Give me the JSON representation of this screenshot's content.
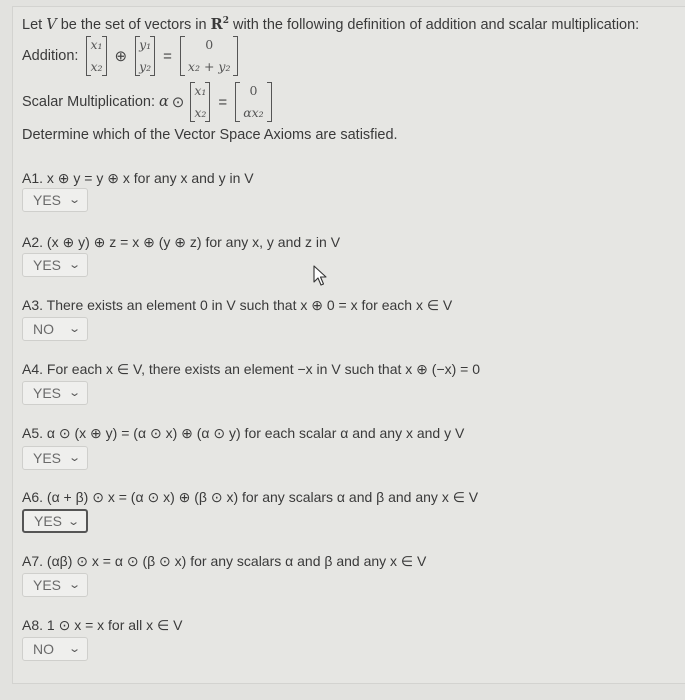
{
  "intro": {
    "line1_pre": "Let ",
    "V": "V",
    "line1_mid": " be the set of vectors in ",
    "R": "R",
    "R_exp": "2",
    "line1_post": " with the following definition of addition and scalar multiplication:",
    "addition_label": "Addition:",
    "addition": {
      "left": [
        "x",
        "y"
      ],
      "x_entries": [
        "x₁",
        "x₂"
      ],
      "y_entries": [
        "y₁",
        "y₂"
      ],
      "result": [
        "0",
        "x₂ + y₂"
      ],
      "op": "⊕",
      "eq": "="
    },
    "scalar_label": "Scalar Multiplication:",
    "scalar": {
      "alpha": "α",
      "op": "⊙",
      "x_entries": [
        "x₁",
        "x₂"
      ],
      "result": [
        "0",
        "αx₂"
      ],
      "eq": "="
    },
    "instruction": "Determine which of the Vector Space Axioms are satisfied."
  },
  "axioms": [
    {
      "id": "A1.",
      "text": "x ⊕ y = y ⊕ x for any x and y in V",
      "answer": "YES"
    },
    {
      "id": "A2.",
      "text": "(x ⊕ y) ⊕ z = x ⊕ (y ⊕ z) for any x, y and z in V",
      "answer": "YES"
    },
    {
      "id": "A3.",
      "text": "There exists an element 0 in V such that x ⊕ 0 = x for each x ∈ V",
      "answer": "NO"
    },
    {
      "id": "A4.",
      "text": "For each x ∈ V, there exists an element −x in V such that x ⊕ (−x) = 0",
      "answer": "YES"
    },
    {
      "id": "A5.",
      "text": "α ⊙ (x ⊕ y) = (α ⊙ x) ⊕ (α ⊙ y) for each scalar α and any x and y V",
      "answer": "YES"
    },
    {
      "id": "A6.",
      "text": "(α + β) ⊙ x = (α ⊙ x) ⊕ (β ⊙ x) for any scalars α and β and any x ∈ V",
      "answer": "YES",
      "focused": true
    },
    {
      "id": "A7.",
      "text": "(αβ) ⊙ x = α ⊙ (β ⊙ x) for any scalars α and β and any x ∈ V",
      "answer": "YES"
    },
    {
      "id": "A8.",
      "text": "1 ⊙ x = x for all x ∈ V",
      "answer": "NO"
    }
  ],
  "dropdown_icon": "chevron-down-icon",
  "cursor_icon": "mouse-pointer-icon"
}
